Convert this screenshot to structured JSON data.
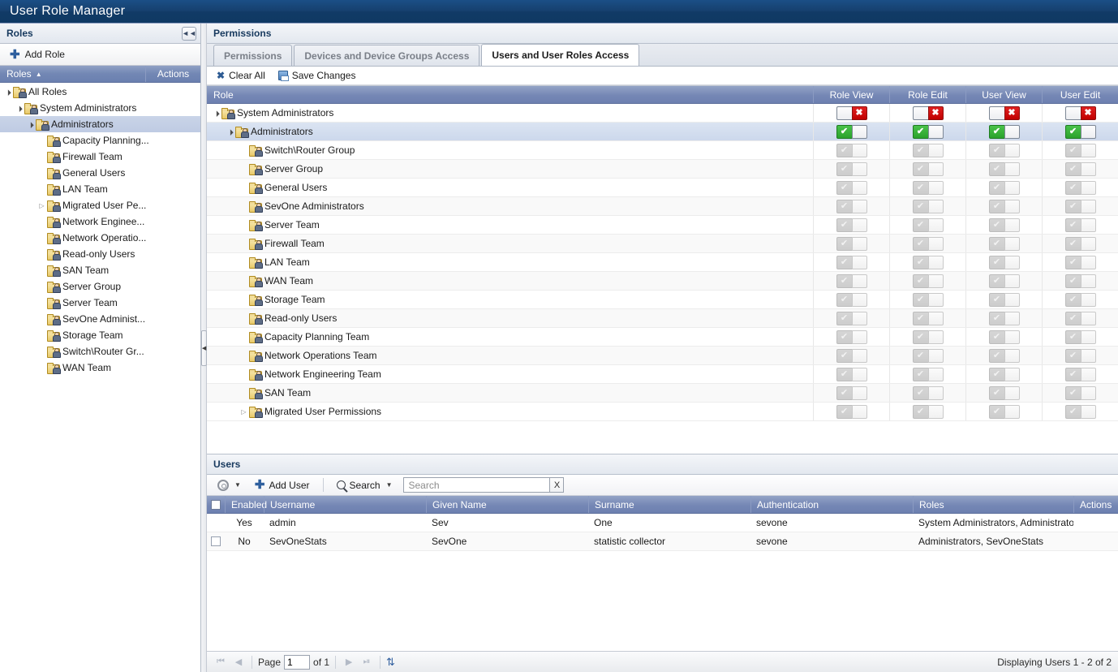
{
  "app": {
    "title": "User Role Manager"
  },
  "sidebar": {
    "header": "Roles",
    "collapse_icon": "collapse-left-icon",
    "add_role_label": "Add Role",
    "columns": {
      "roles": "Roles",
      "actions": "Actions"
    },
    "sort_indicator": "sort-asc-icon",
    "tree": [
      {
        "label": "All Roles",
        "depth": 0,
        "expander": "open",
        "selected": false
      },
      {
        "label": "System Administrators",
        "depth": 1,
        "expander": "open",
        "selected": false
      },
      {
        "label": "Administrators",
        "depth": 2,
        "expander": "open",
        "selected": true
      },
      {
        "label": "Capacity Planning...",
        "depth": 3,
        "expander": "none",
        "selected": false
      },
      {
        "label": "Firewall Team",
        "depth": 3,
        "expander": "none",
        "selected": false
      },
      {
        "label": "General Users",
        "depth": 3,
        "expander": "none",
        "selected": false
      },
      {
        "label": "LAN Team",
        "depth": 3,
        "expander": "none",
        "selected": false
      },
      {
        "label": "Migrated User Pe...",
        "depth": 3,
        "expander": "closed",
        "selected": false
      },
      {
        "label": "Network Enginee...",
        "depth": 3,
        "expander": "none",
        "selected": false
      },
      {
        "label": "Network Operatio...",
        "depth": 3,
        "expander": "none",
        "selected": false
      },
      {
        "label": "Read-only Users",
        "depth": 3,
        "expander": "none",
        "selected": false
      },
      {
        "label": "SAN Team",
        "depth": 3,
        "expander": "none",
        "selected": false
      },
      {
        "label": "Server Group",
        "depth": 3,
        "expander": "none",
        "selected": false
      },
      {
        "label": "Server Team",
        "depth": 3,
        "expander": "none",
        "selected": false
      },
      {
        "label": "SevOne Administ...",
        "depth": 3,
        "expander": "none",
        "selected": false
      },
      {
        "label": "Storage Team",
        "depth": 3,
        "expander": "none",
        "selected": false
      },
      {
        "label": "Switch\\Router Gr...",
        "depth": 3,
        "expander": "none",
        "selected": false
      },
      {
        "label": "WAN Team",
        "depth": 3,
        "expander": "none",
        "selected": false
      }
    ]
  },
  "permissions": {
    "header": "Permissions",
    "tabs": [
      {
        "label": "Permissions",
        "active": false
      },
      {
        "label": "Devices and Device Groups Access",
        "active": false
      },
      {
        "label": "Users and User Roles Access",
        "active": true
      }
    ],
    "actions": [
      {
        "label": "Clear All",
        "icon": "x-icon"
      },
      {
        "label": "Save Changes",
        "icon": "save-disk-icon"
      }
    ],
    "columns": [
      "Role",
      "Role View",
      "Role Edit",
      "User View",
      "User Edit"
    ],
    "rows": [
      {
        "label": "System Administrators",
        "depth": 0,
        "expander": "open",
        "selected": false,
        "states": [
          "off",
          "off",
          "off",
          "off"
        ]
      },
      {
        "label": "Administrators",
        "depth": 1,
        "expander": "open",
        "selected": true,
        "states": [
          "on",
          "on",
          "on",
          "on"
        ]
      },
      {
        "label": "Switch\\Router Group",
        "depth": 2,
        "expander": "none",
        "selected": false,
        "states": [
          "dis",
          "dis",
          "dis",
          "dis"
        ]
      },
      {
        "label": "Server Group",
        "depth": 2,
        "expander": "none",
        "selected": false,
        "states": [
          "dis",
          "dis",
          "dis",
          "dis"
        ]
      },
      {
        "label": "General Users",
        "depth": 2,
        "expander": "none",
        "selected": false,
        "states": [
          "dis",
          "dis",
          "dis",
          "dis"
        ]
      },
      {
        "label": "SevOne Administrators",
        "depth": 2,
        "expander": "none",
        "selected": false,
        "states": [
          "dis",
          "dis",
          "dis",
          "dis"
        ]
      },
      {
        "label": "Server Team",
        "depth": 2,
        "expander": "none",
        "selected": false,
        "states": [
          "dis",
          "dis",
          "dis",
          "dis"
        ]
      },
      {
        "label": "Firewall Team",
        "depth": 2,
        "expander": "none",
        "selected": false,
        "states": [
          "dis",
          "dis",
          "dis",
          "dis"
        ]
      },
      {
        "label": "LAN Team",
        "depth": 2,
        "expander": "none",
        "selected": false,
        "states": [
          "dis",
          "dis",
          "dis",
          "dis"
        ]
      },
      {
        "label": "WAN Team",
        "depth": 2,
        "expander": "none",
        "selected": false,
        "states": [
          "dis",
          "dis",
          "dis",
          "dis"
        ]
      },
      {
        "label": "Storage Team",
        "depth": 2,
        "expander": "none",
        "selected": false,
        "states": [
          "dis",
          "dis",
          "dis",
          "dis"
        ]
      },
      {
        "label": "Read-only Users",
        "depth": 2,
        "expander": "none",
        "selected": false,
        "states": [
          "dis",
          "dis",
          "dis",
          "dis"
        ]
      },
      {
        "label": "Capacity Planning Team",
        "depth": 2,
        "expander": "none",
        "selected": false,
        "states": [
          "dis",
          "dis",
          "dis",
          "dis"
        ]
      },
      {
        "label": "Network Operations Team",
        "depth": 2,
        "expander": "none",
        "selected": false,
        "states": [
          "dis",
          "dis",
          "dis",
          "dis"
        ]
      },
      {
        "label": "Network Engineering Team",
        "depth": 2,
        "expander": "none",
        "selected": false,
        "states": [
          "dis",
          "dis",
          "dis",
          "dis"
        ]
      },
      {
        "label": "SAN Team",
        "depth": 2,
        "expander": "none",
        "selected": false,
        "states": [
          "dis",
          "dis",
          "dis",
          "dis"
        ]
      },
      {
        "label": "Migrated User Permissions",
        "depth": 2,
        "expander": "closed",
        "selected": false,
        "states": [
          "dis",
          "dis",
          "dis",
          "dis"
        ]
      }
    ]
  },
  "users": {
    "header": "Users",
    "toolbar": {
      "gear_icon": "gear-icon",
      "gear_caret": "chevron-down-icon",
      "add_user_label": "Add User",
      "add_user_icon": "plus-icon",
      "search_label": "Search",
      "search_icon": "magnifier-icon",
      "search_caret": "chevron-down-icon",
      "search_value": "",
      "search_placeholder": "Search",
      "clear_label": "X"
    },
    "columns": [
      "",
      "Enabled",
      "Username",
      "Given Name",
      "Surname",
      "Authentication",
      "Roles",
      "Actions"
    ],
    "rows": [
      {
        "checkbox": false,
        "show_checkbox": false,
        "enabled": "Yes",
        "username": "admin",
        "given_name": "Sev",
        "surname": "One",
        "authentication": "sevone",
        "roles": "System Administrators, Administrators"
      },
      {
        "checkbox": false,
        "show_checkbox": true,
        "enabled": "No",
        "username": "SevOneStats",
        "given_name": "SevOne",
        "surname": "statistic collector",
        "authentication": "sevone",
        "roles": "Administrators, SevOneStats"
      }
    ],
    "pagination": {
      "first_icon": "first-page-icon",
      "prev_icon": "previous-page-icon",
      "page_label": "Page",
      "page_value": "1",
      "of_label": "of 1",
      "next_icon": "next-page-icon",
      "last_icon": "last-page-icon",
      "refresh_icon": "refresh-icon",
      "status": "Displaying Users 1 - 2 of 2"
    }
  },
  "colors": {
    "title_bar": "#16406e",
    "grid_header": "#7587b5",
    "selection": "#c9d4e8",
    "toggle_on": "#2aa22c",
    "toggle_off": "#c00000",
    "accent_link": "#2d5b93"
  }
}
